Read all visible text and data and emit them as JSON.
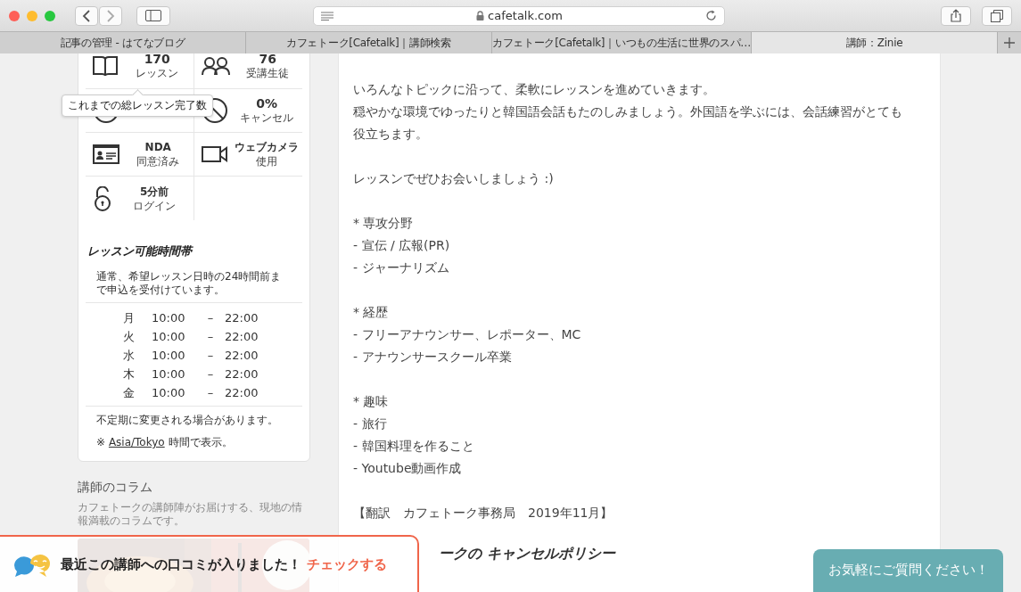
{
  "browser": {
    "url": "cafetalk.com",
    "tabs": [
      {
        "title": "記事の管理 - はてなブログ",
        "selected": false
      },
      {
        "title": "カフェトーク[Cafetalk]｜講師検索",
        "selected": false
      },
      {
        "title": "カフェトーク[Cafetalk]｜いつもの生活に世界のスパ…",
        "selected": false
      },
      {
        "title": "講師：Zinie",
        "selected": true
      }
    ]
  },
  "stats": [
    {
      "kind": "book",
      "value": "170",
      "label": "レッスン"
    },
    {
      "kind": "people",
      "value": "76",
      "label": "受講生徒"
    },
    {
      "kind": "clock"
    },
    {
      "kind": "cancel",
      "value": "0%",
      "label": "キャンセル"
    },
    {
      "kind": "idcard",
      "value": "NDA",
      "label": "同意済み"
    },
    {
      "kind": "camera",
      "value": "ウェブカメラ",
      "label": "使用"
    },
    {
      "kind": "lock",
      "value": "5分前",
      "label": "ログイン"
    }
  ],
  "tooltip": "これまでの総レッスン完了数",
  "schedule": {
    "title": "レッスン可能時間帯",
    "note": "通常、希望レッスン日時の24時間前まで申込を受付けています。",
    "rows": [
      {
        "day": "月",
        "start": "10:00",
        "dash": "–",
        "end": "22:00"
      },
      {
        "day": "火",
        "start": "10:00",
        "dash": "–",
        "end": "22:00"
      },
      {
        "day": "水",
        "start": "10:00",
        "dash": "–",
        "end": "22:00"
      },
      {
        "day": "木",
        "start": "10:00",
        "dash": "–",
        "end": "22:00"
      },
      {
        "day": "金",
        "start": "10:00",
        "dash": "–",
        "end": "22:00"
      }
    ],
    "footer": "不定期に変更される場合があります。",
    "tz_prefix": "※",
    "tz_link": "Asia/Tokyo",
    "tz_suffix": "時間で表示。"
  },
  "column": {
    "title": "講師のコラム",
    "description": "カフェトークの講師陣がお届けする、現地の情報満載のコラムです。"
  },
  "profile": {
    "paragraphs": [
      [
        "いろんなトピックに沿って、柔軟にレッスンを進めていきます。",
        "穏やかな環境でゆったりと韓国語会話もたのしみましょう。外国語を学ぶには、会話練習がとても役立ちます。"
      ],
      [
        "レッスンでぜひお会いしましょう :)"
      ],
      [
        "* 専攻分野",
        "- 宣伝 / 広報(PR)",
        "- ジャーナリズム"
      ],
      [
        "* 経歴",
        "- フリーアナウンサー、レポーター、MC",
        "- アナウンサースクール卒業"
      ],
      [
        "* 趣味",
        "- 旅行",
        "- 韓国料理を作ること",
        "- Youtube動画作成"
      ],
      [
        "【翻訳　カフェトーク事務局　2019年11月】"
      ]
    ],
    "policy_heading": "ークの キャンセルポリシー"
  },
  "notice": {
    "text": "最近この講師への口コミが入りました！",
    "link": "チェックする"
  },
  "chat_button": "お気軽にご質問ください！"
}
